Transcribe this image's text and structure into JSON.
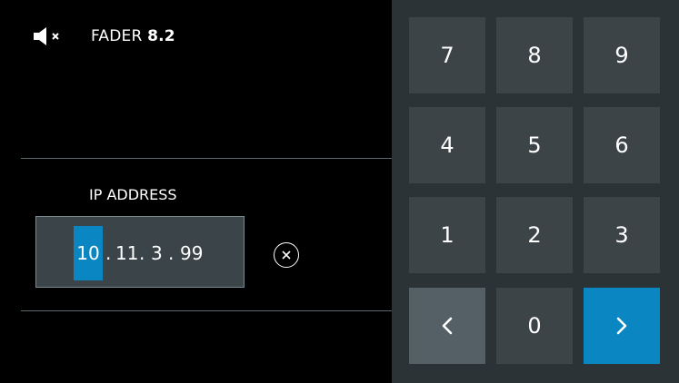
{
  "header": {
    "app_name": "FADER",
    "version": "8.2",
    "mute_icon": "speaker-muted-icon"
  },
  "ip": {
    "label": "IP ADDRESS",
    "octets": [
      "10",
      "11",
      "3",
      "99"
    ],
    "active_octet": 0,
    "clear_icon": "clear-icon"
  },
  "keypad": {
    "keys": [
      "7",
      "8",
      "9",
      "4",
      "5",
      "6",
      "1",
      "2",
      "3"
    ],
    "zero": "0",
    "back_icon": "chevron-left-icon",
    "next_icon": "chevron-right-icon"
  },
  "colors": {
    "accent": "#0a86c2",
    "panel": "#2c3336",
    "key": "#3c4448",
    "key_back": "#556066"
  }
}
